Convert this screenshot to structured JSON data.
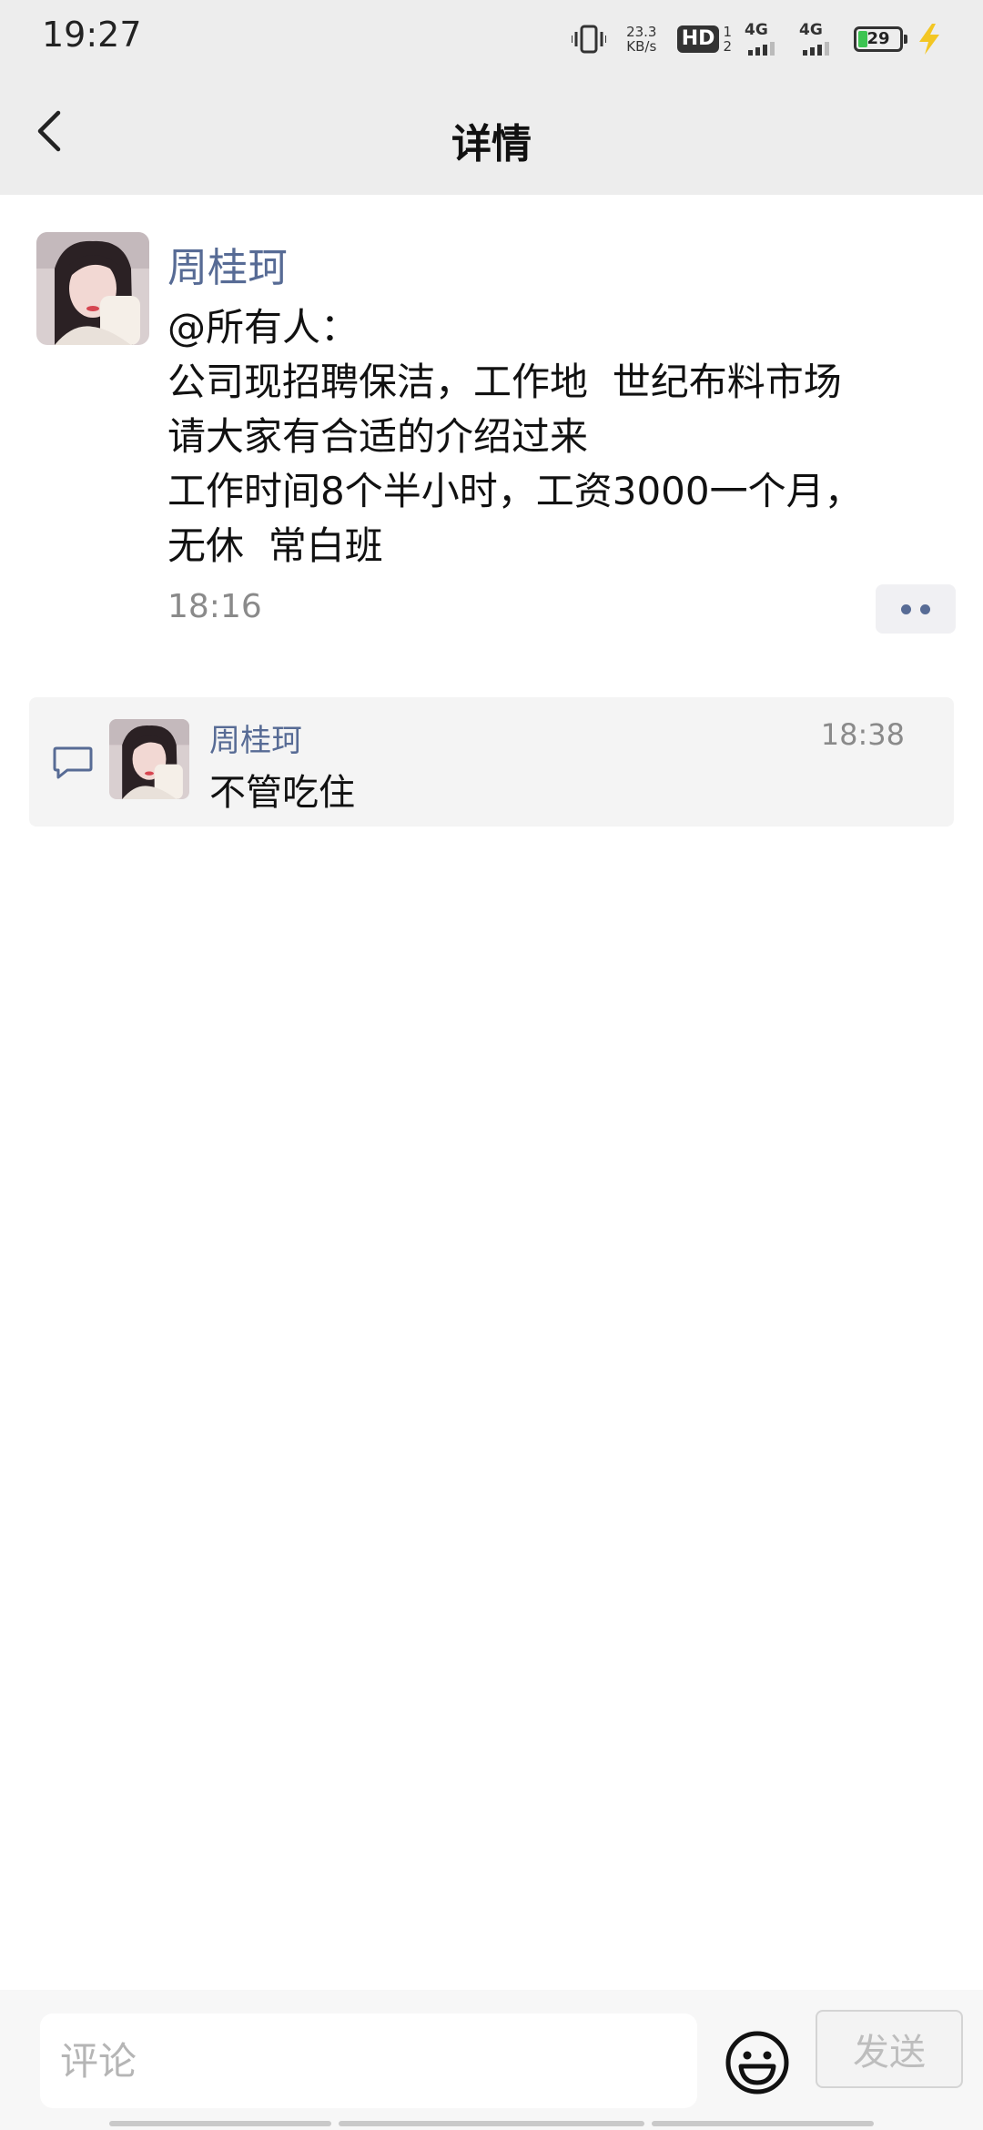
{
  "status_bar": {
    "time": "19:27",
    "net_speed_value": "23.3",
    "net_speed_unit": "KB/s",
    "hd_label": "HD",
    "hd_sub_top": "1",
    "hd_sub_bottom": "2",
    "sim1_label": "4G",
    "sim2_label": "4G",
    "battery_level": "29",
    "icons": [
      "vibrate-icon",
      "hd-call-icon",
      "signal-4g-icon",
      "signal-4g-icon",
      "battery-icon",
      "charging-icon"
    ]
  },
  "nav": {
    "title": "详情",
    "back_icon": "chevron-left-icon"
  },
  "post": {
    "author": "周桂珂",
    "lines": [
      "@所有人：",
      "公司现招聘保洁，工作地  世纪布料市场",
      "请大家有合适的介绍过来",
      "工作时间8个半小时，工资3000一个月，",
      "无休  常白班"
    ],
    "time": "18:16",
    "more_icon": "more-dots-icon"
  },
  "comments": [
    {
      "author": "周桂珂",
      "text": "不管吃住",
      "time": "18:38"
    }
  ],
  "input_bar": {
    "placeholder": "评论",
    "send_label": "发送",
    "emoji_icon": "emoji-icon"
  },
  "colors": {
    "link_blue": "#576b95",
    "header_bg": "#ededed",
    "comment_bg": "#f4f4f4"
  }
}
